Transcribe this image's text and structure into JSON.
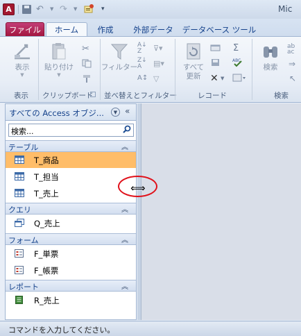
{
  "title_bar": {
    "app_icon_letter": "A",
    "window_title": "Mic"
  },
  "tabs": {
    "file": "ファイル",
    "home": "ホーム",
    "create": "作成",
    "external": "外部データ",
    "dbtools": "データベース ツール"
  },
  "ribbon": {
    "view_label": "表示",
    "views_group": "表示",
    "paste_label": "貼り付け",
    "clipboard_group": "クリップボード",
    "filter_label": "フィルター",
    "sortfilter_group": "並べ替えとフィルター",
    "refresh_label_line1": "すべて",
    "refresh_label_line2": "更新",
    "records_group": "レコード",
    "find_label": "検索",
    "find_group": "検索"
  },
  "nav_pane": {
    "title": "すべての Access オブジ...",
    "search_placeholder": "検索...",
    "groups": [
      {
        "name": "テーブル",
        "items": [
          "T_商品",
          "T_担当",
          "T_売上"
        ],
        "selected_index": 0
      },
      {
        "name": "クエリ",
        "items": [
          "Q_売上"
        ]
      },
      {
        "name": "フォーム",
        "items": [
          "F_単票",
          "F_帳票"
        ]
      },
      {
        "name": "レポート",
        "items": [
          "R_売上"
        ]
      }
    ]
  },
  "status_bar": {
    "text": "コマンドを入力してください。"
  },
  "colors": {
    "accent_file_tab": "#a3163f",
    "selected_item": "#ffbd69",
    "annotation_ellipse": "#e0101a"
  }
}
